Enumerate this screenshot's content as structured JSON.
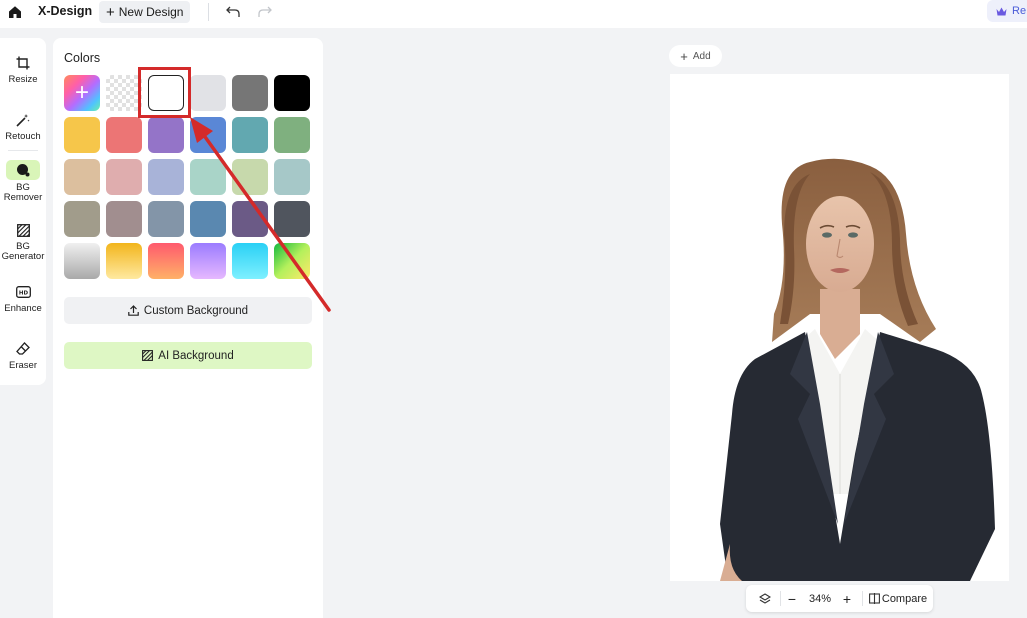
{
  "app": {
    "title": "X-Design",
    "new_design_label": "New Design",
    "topright_label": "Re"
  },
  "tools": [
    {
      "label": "Resize",
      "icon": "crop-icon"
    },
    {
      "label": "Retouch",
      "icon": "magic-wand-icon"
    },
    {
      "label": "BG Remover",
      "icon": "bg-remover-icon",
      "active": true
    },
    {
      "label": "BG Generator",
      "icon": "hatch-square-icon"
    },
    {
      "label": "Enhance",
      "icon": "hd-icon"
    },
    {
      "label": "Eraser",
      "icon": "eraser-icon"
    }
  ],
  "colors_panel": {
    "title": "Colors",
    "swatches": [
      [
        "add",
        "transparent",
        "#ffffff",
        "#e1e2e6",
        "#767676",
        "#000000"
      ],
      [
        "#f6c64a",
        "#ec7575",
        "#9474c8",
        "#5a87d6",
        "#62a8b0",
        "#7fb07f"
      ],
      [
        "#dcbf9e",
        "#dfadae",
        "#a8b3d8",
        "#a9d4c8",
        "#c7d9ac",
        "#a6c8c8"
      ],
      [
        "#a19c8b",
        "#a18e8f",
        "#8395a8",
        "#5a88b0",
        "#6b5a86",
        "#50555e"
      ],
      [
        "linear-gradient(180deg,#f0f0f0,#a9a9a9)",
        "linear-gradient(180deg,#f2b51c,#ffe9a0)",
        "linear-gradient(180deg,#ff5a6e,#ffb167)",
        "linear-gradient(180deg,#9b7cff,#e6b8ff)",
        "linear-gradient(180deg,#2ad0f5,#7ef0ff)",
        "linear-gradient(135deg,#13b93f,#b4f05c,#ffe96a)"
      ]
    ],
    "selected": "#ffffff",
    "custom_background_label": "Custom Background",
    "ai_background_label": "AI Background"
  },
  "canvas": {
    "add_label": "Add",
    "zoom": "34%",
    "compare_label": "Compare"
  },
  "colors": {
    "accent_green": "#d9f5b8",
    "highlight_red": "#d42a2a"
  }
}
